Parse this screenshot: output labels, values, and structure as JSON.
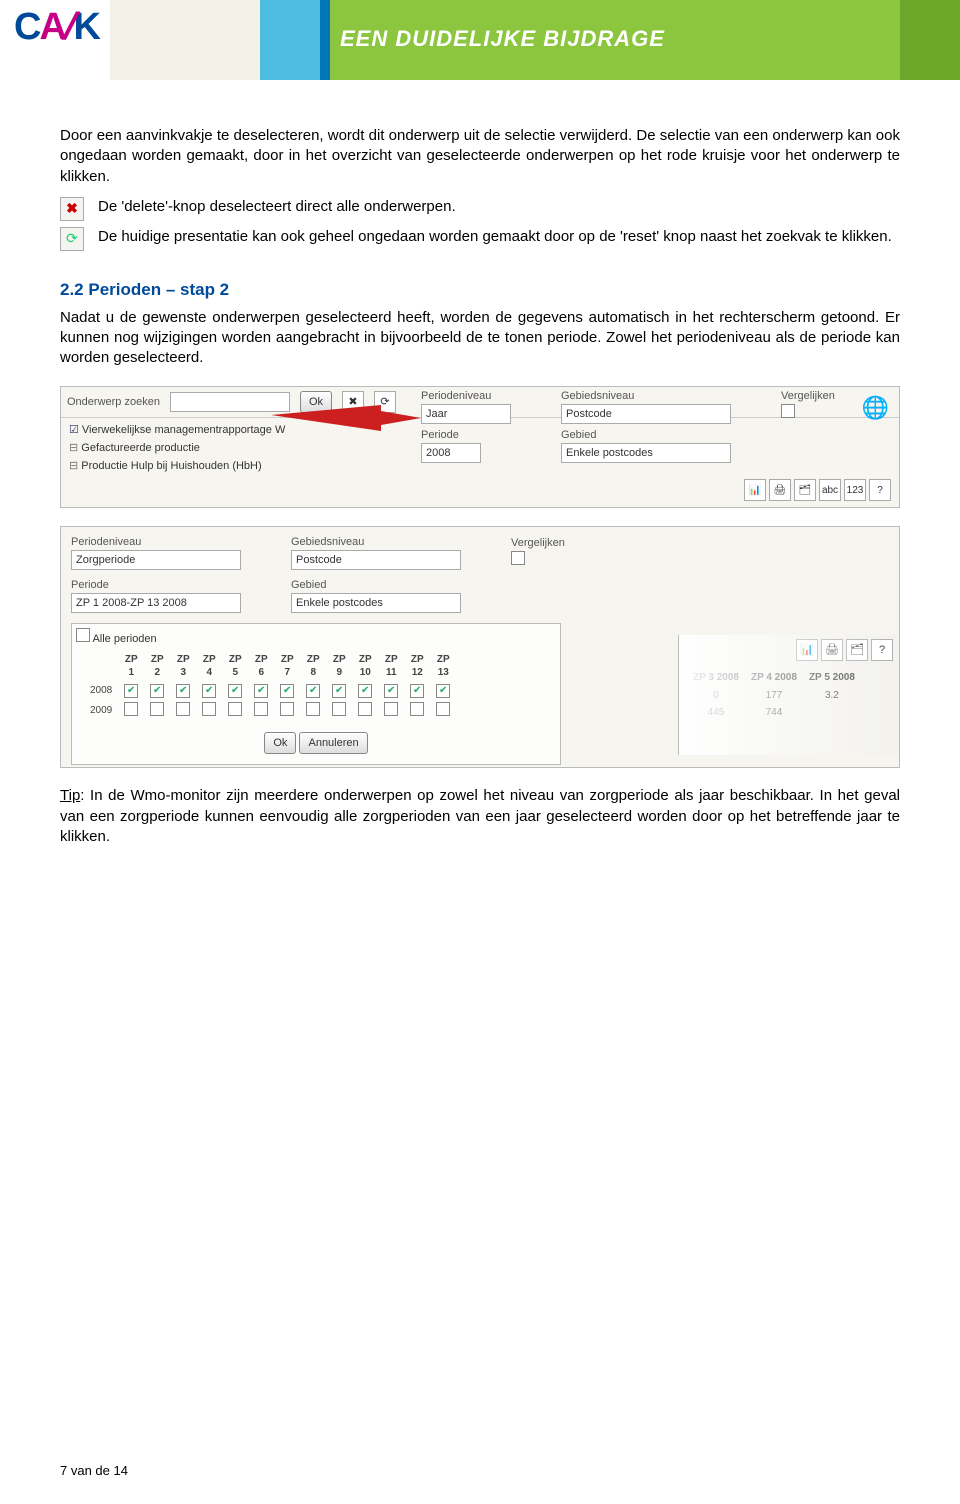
{
  "banner": {
    "logo_pre": "C",
    "logo_slash": "/",
    "logo_post": "K",
    "tagline": "EEN DUIDELIJKE BIJDRAGE"
  },
  "para1": "Door een aanvinkvakje te deselecteren, wordt dit onderwerp uit de selectie verwijderd. De selectie van een onderwerp kan ook ongedaan worden gemaakt, door in het overzicht van geselecteerde onderwerpen op het rode kruisje voor het onderwerp te klikken.",
  "row_delete": "De 'delete'-knop deselecteert direct alle onderwerpen.",
  "row_reset": "De huidige presentatie kan ook geheel ongedaan worden gemaakt door op de 'reset' knop naast het zoekvak te klikken.",
  "h2_1": "2.2 Perioden – stap 2",
  "para2": "Nadat u de gewenste onderwerpen geselecteerd heeft, worden de gegevens automatisch in het rechterscherm getoond. Er kunnen nog wijzigingen worden aangebracht in bijvoorbeeld de te tonen periode. Zowel het periodeniveau als de periode kan worden geselecteerd.",
  "shot1": {
    "search_label": "Onderwerp zoeken",
    "ok": "Ok",
    "tree1": "Vierwekelijkse managementrapportage W",
    "tree2": "Gefactureerde productie",
    "tree3": "Productie Hulp bij Huishouden (HbH)",
    "cols": {
      "periodeniveau": "Periodeniveau",
      "periodeniveau_v": "Jaar",
      "periode": "Periode",
      "periode_v": "2008",
      "gebiedsniveau": "Gebiedsniveau",
      "gebiedsniveau_v": "Postcode",
      "gebied": "Gebied",
      "gebied_v": "Enkele postcodes",
      "vergelijken": "Vergelijken"
    },
    "icons": [
      "📊",
      "🖨",
      "🗂",
      "abc",
      "123",
      "?"
    ]
  },
  "shot2": {
    "periodeniveau": "Periodeniveau",
    "periodeniveau_v": "Zorgperiode",
    "gebiedsniveau": "Gebiedsniveau",
    "gebiedsniveau_v": "Postcode",
    "vergelijken": "Vergelijken",
    "periode": "Periode",
    "periode_v": "ZP 1 2008-ZP 13 2008",
    "gebied": "Gebied",
    "gebied_v": "Enkele postcodes",
    "alle": "Alle perioden",
    "zp_cols": [
      "ZP 1",
      "ZP 2",
      "ZP 3",
      "ZP 4",
      "ZP 5",
      "ZP 6",
      "ZP 7",
      "ZP 8",
      "ZP 9",
      "ZP 10",
      "ZP 11",
      "ZP 12",
      "ZP 13"
    ],
    "rows": [
      {
        "year": "2008",
        "checked": true
      },
      {
        "year": "2009",
        "checked": false
      }
    ],
    "ok": "Ok",
    "cancel": "Annuleren",
    "side_cols": [
      "ZP 3 2008",
      "ZP 4 2008",
      "ZP 5 2008"
    ],
    "side_r1": [
      "0",
      "177",
      "3.2"
    ],
    "side_r2": [
      "445",
      "744",
      ""
    ]
  },
  "tip_label": "Tip",
  "tip": ": In de Wmo-monitor zijn meerdere onderwerpen op zowel het niveau van zorgperiode als jaar beschikbaar. In het geval van een zorgperiode kunnen eenvoudig alle zorgperioden van een jaar geselecteerd worden door op het betreffende jaar te klikken.",
  "footer": "7 van de 14"
}
